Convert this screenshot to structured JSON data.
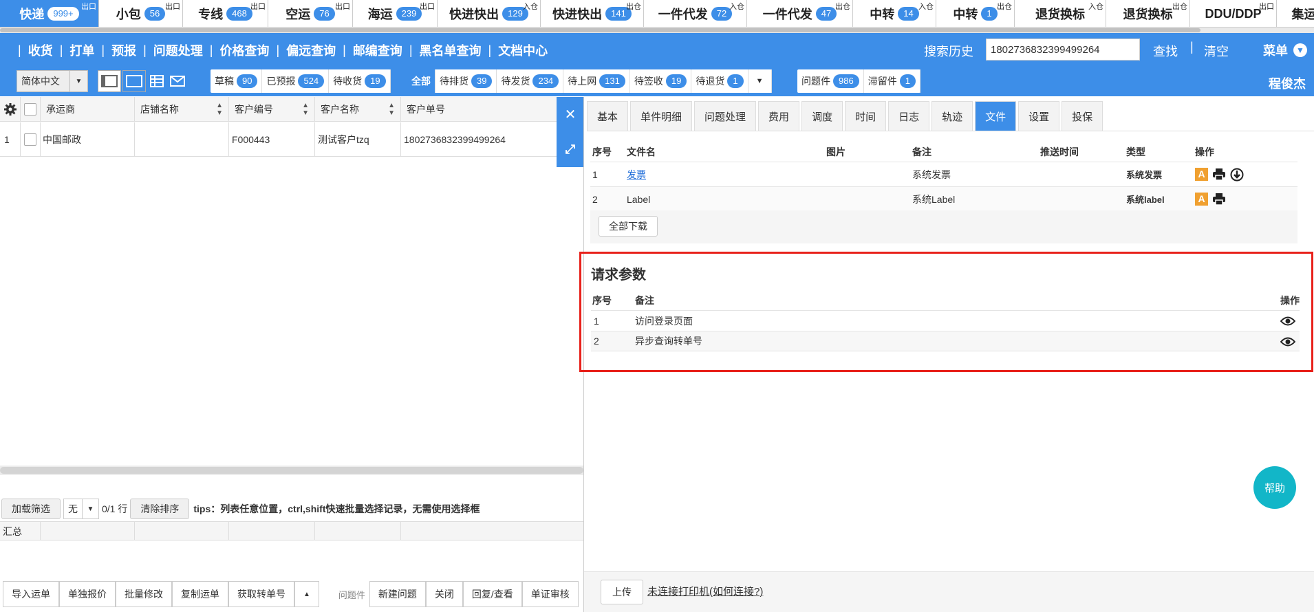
{
  "top_tabs": [
    {
      "label": "快递",
      "count": "999+",
      "tag": "出口",
      "active": true
    },
    {
      "label": "小包",
      "count": "56",
      "tag": "出口"
    },
    {
      "label": "专线",
      "count": "468",
      "tag": "出口"
    },
    {
      "label": "空运",
      "count": "76",
      "tag": "出口"
    },
    {
      "label": "海运",
      "count": "239",
      "tag": "出口"
    },
    {
      "label": "快进快出",
      "count": "129",
      "tag": "入仓"
    },
    {
      "label": "快进快出",
      "count": "141",
      "tag": "出仓"
    },
    {
      "label": "一件代发",
      "count": "72",
      "tag": "入仓"
    },
    {
      "label": "一件代发",
      "count": "47",
      "tag": "出仓"
    },
    {
      "label": "中转",
      "count": "14",
      "tag": "入仓"
    },
    {
      "label": "中转",
      "count": "1",
      "tag": "出仓"
    },
    {
      "label": "退货换标",
      "count": "",
      "tag": "入仓"
    },
    {
      "label": "退货换标",
      "count": "",
      "tag": "出仓"
    },
    {
      "label": "DDU/DDP",
      "count": "",
      "tag": "出口"
    },
    {
      "label": "集运",
      "count": "",
      "tag": ""
    }
  ],
  "nav": {
    "items": [
      "收货",
      "打单",
      "预报",
      "问题处理",
      "价格查询",
      "偏远查询",
      "邮编查询",
      "黑名单查询",
      "文档中心"
    ],
    "search_history": "搜索历史",
    "search_value": "18027368323994992­64",
    "find": "查找",
    "separator": "|",
    "clear": "清空",
    "menu": "菜单",
    "menu_chevron": "▼"
  },
  "filter": {
    "language": "简体中文",
    "dd_arrow": "▼",
    "group1": [
      {
        "label": "草稿",
        "count": "90"
      },
      {
        "label": "已预报",
        "count": "524"
      },
      {
        "label": "待收货",
        "count": "19"
      }
    ],
    "all": "全部",
    "group2": [
      {
        "label": "待排货",
        "count": "39"
      },
      {
        "label": "待发货",
        "count": "234"
      },
      {
        "label": "待上网",
        "count": "131"
      },
      {
        "label": "待签收",
        "count": "19"
      },
      {
        "label": "待退货",
        "count": "1"
      }
    ],
    "group3": [
      {
        "label": "问题件",
        "count": "986"
      },
      {
        "label": "滞留件",
        "count": "1"
      }
    ],
    "user": "程俊杰"
  },
  "grid": {
    "columns": [
      "承运商",
      "店铺名称",
      "客户编号",
      "客户名称",
      "客户单号"
    ],
    "row": {
      "index": "1",
      "carrier": "中国邮政",
      "shop": "",
      "customer_no": "F000443",
      "customer_name": "测试客户tzq",
      "order_no": "1802736832399499264"
    },
    "load_filter": "加载筛选",
    "none": "无",
    "rows_count": "0/1 行",
    "clear_sort": "清除排序",
    "tips": "tips：列表任意位置，ctrl,shift快速批量选择记录，无需使用选择框",
    "summary": "汇总"
  },
  "bottom_buttons": [
    "导入运单",
    "单独报价",
    "批量修改",
    "复制运单",
    "获取转单号"
  ],
  "bottom_up": "▲",
  "issue_label": "问题件",
  "issue_buttons": [
    "新建问题",
    "关闭",
    "回复/查看",
    "单证审核"
  ],
  "side": {
    "close": "✕",
    "expand": "⤢"
  },
  "right_tabs": [
    "基本",
    "单件明细",
    "问题处理",
    "费用",
    "调度",
    "时间",
    "日志",
    "轨迹",
    "文件",
    "设置",
    "投保"
  ],
  "right_active_tab": "文件",
  "files": {
    "headers": [
      "序号",
      "文件名",
      "图片",
      "备注",
      "推送时间",
      "类型",
      "操作"
    ],
    "rows": [
      {
        "no": "1",
        "name": "发票",
        "remark": "系统发票",
        "type": "系统发票",
        "link": true,
        "download": true
      },
      {
        "no": "2",
        "name": "Label",
        "remark": "系统Label",
        "type": "系统label",
        "link": false,
        "download": false
      }
    ],
    "icon_a": "A",
    "download_all": "全部下载"
  },
  "request_params": {
    "title": "请求参数",
    "headers": [
      "序号",
      "备注",
      "操作"
    ],
    "rows": [
      {
        "no": "1",
        "remark": "访问登录页面"
      },
      {
        "no": "2",
        "remark": "异步查询转单号"
      }
    ]
  },
  "help": "帮助",
  "upload": "上传",
  "printer_link": "未连接打印机(如何连接?)",
  "colors": {
    "primary": "#3d8ee8",
    "highlight_border": "#e8211b",
    "help_bg": "#12b6c8",
    "icon_orange": "#f0a030"
  }
}
